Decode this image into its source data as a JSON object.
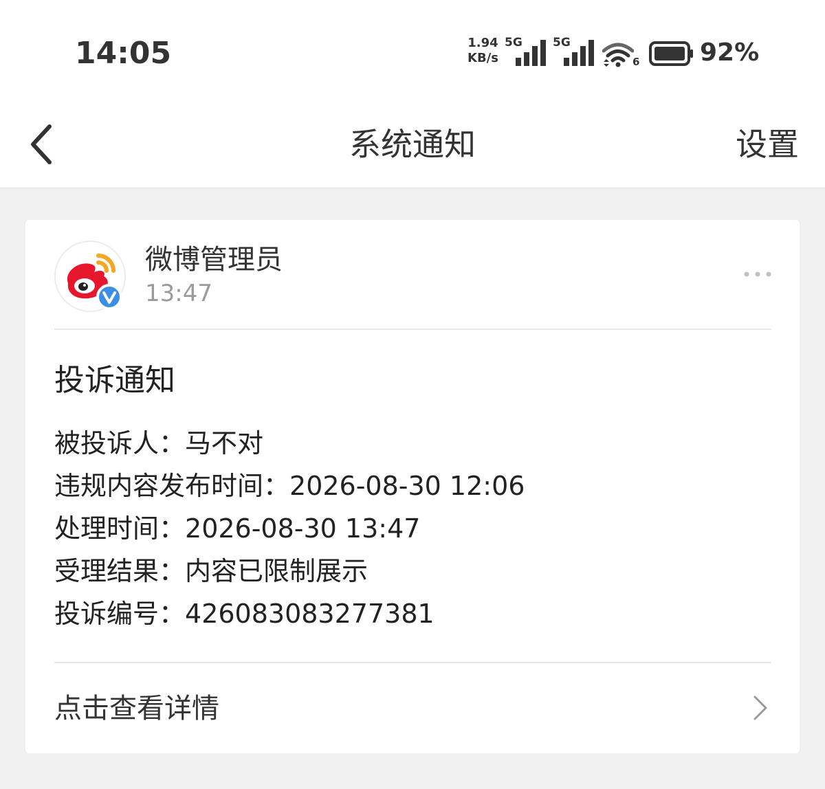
{
  "status_bar": {
    "time": "14:05",
    "net_speed_value": "1.94",
    "net_speed_unit": "KB/s",
    "network_1": "5G",
    "network_2": "5G",
    "wifi_badge": "6",
    "battery": "92%"
  },
  "nav": {
    "title": "系统通知",
    "settings_label": "设置"
  },
  "message": {
    "sender": "微博管理员",
    "time": "13:47",
    "title": "投诉通知",
    "rows": [
      {
        "label": "被投诉人：",
        "value": "马不对"
      },
      {
        "label": "违规内容发布时间：",
        "value": "2026-08-30 12:06"
      },
      {
        "label": "处理时间：",
        "value": "2026-08-30 13:47"
      },
      {
        "label": "受理结果：",
        "value": "内容已限制展示"
      },
      {
        "label": "投诉编号：",
        "value": "426083083277381"
      }
    ],
    "details_label": "点击查看详情"
  },
  "colors": {
    "weibo_red": "#e6162d",
    "weibo_orange": "#f5a623",
    "verified_blue": "#3a8ee6"
  }
}
